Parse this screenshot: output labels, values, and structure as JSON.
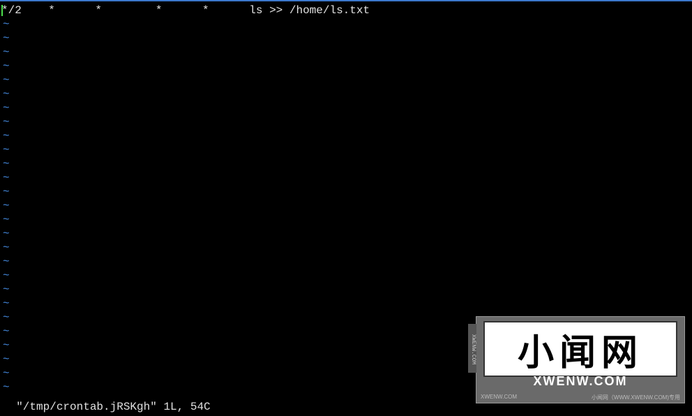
{
  "editor": {
    "content_line": "*/2    *      *        *      *      ls >> /home/ls.txt",
    "tilde": "~",
    "tilde_count": 27
  },
  "status": {
    "text": "\"/tmp/crontab.jRSKgh\" 1L, 54C"
  },
  "watermark": {
    "title": "小闻网",
    "subtitle": "XWENW.COM",
    "side": "XWENW.COM",
    "footer_left": "XWENW.COM",
    "footer_right": "小闻网（WWW.XWENW.COM)专用"
  }
}
